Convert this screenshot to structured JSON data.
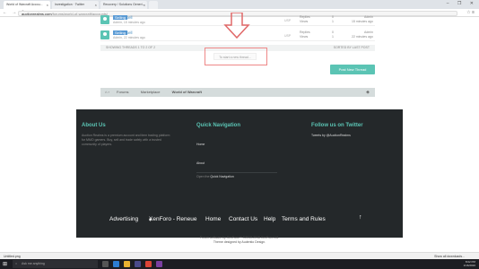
{
  "browser": {
    "tabs": [
      {
        "label": "World of Warcraft Accou...",
        "active": true
      },
      {
        "label": "Investigation · Twitter",
        "active": false
      },
      {
        "label": "Recovery / Solutions Generi...",
        "active": false
      },
      {
        "label": "",
        "active": false
      }
    ],
    "url_domain": "auctionrealms.com",
    "url_path": "/forums/world-of-warcraft/accounts/",
    "window_controls": "– ❐ ✕"
  },
  "threads": [
    {
      "prefix": "Selling",
      "title": "Sell",
      "meta": "Admin, 15 minutes ago",
      "flag": "USP",
      "stats_labels": "Replies\nViews",
      "stats_values": "0\n1",
      "last": "Admin\n15 minutes ago"
    },
    {
      "prefix": "Selling",
      "title": "Sell",
      "meta": "Admin, 22 minutes ago",
      "flag": "USP",
      "stats_labels": "Replies\nViews",
      "stats_values": "0\n1",
      "last": "Admin\n22 minutes ago"
    }
  ],
  "pager": {
    "left": "SHOWING THREADS 1 TO 2 OF 2",
    "right": "SORTED BY LAST POST"
  },
  "to_new_thread": "To start a new thread...",
  "post_new_thread": "Post New Thread",
  "breadcrumb": [
    "Forums",
    "Marketplace",
    "World of Warcraft"
  ],
  "footer": {
    "about_title": "About Us",
    "about_text": "Auction Realms is a premium account and item trading platform for MMO gamers. Buy, sell and trade safely with a trusted community of players.",
    "quick_nav_title": "Quick Navigation",
    "quick_nav_home": "Home",
    "quick_nav_about": "About",
    "open_quick_nav_prefix": "Open the",
    "open_quick_nav_link": "Quick Navigation",
    "follow_title": "Follow us on Twitter",
    "tweets_by": "Tweets by @AuctionRealms",
    "links": [
      "Advertising",
      "XenForo - Reneue",
      "Home",
      "Contact Us",
      "Help",
      "Terms and Rules"
    ],
    "up_arrow": "↑"
  },
  "copyright": [
    "Forum software by XenForo™ ©2010-2016 XenForo Ltd.",
    "Theme designed by Audentio Design."
  ],
  "status": {
    "download": "Untitled.png",
    "show_all": "Show all downloads..."
  },
  "taskbar": {
    "search_placeholder": "Ask me anything",
    "time": "8:02 PM",
    "date": "1/16/2016"
  }
}
